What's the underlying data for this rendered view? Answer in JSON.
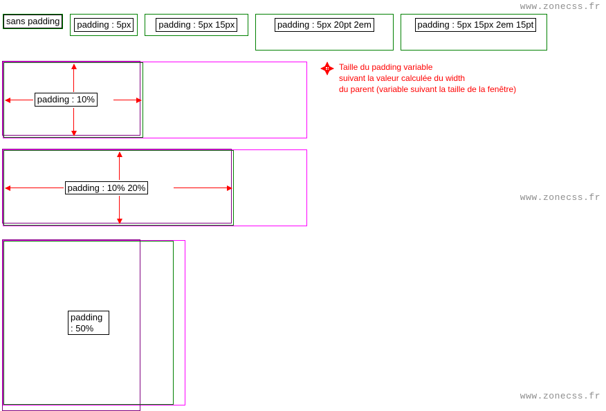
{
  "watermark": "www.zonecss.fr",
  "row1": {
    "box0": "sans padding",
    "box1": "padding : 5px",
    "box2": "padding : 5px 15px",
    "box3": "padding : 5px 20pt 2em",
    "box4": "padding : 5px 15px 2em 15pt"
  },
  "demo1": {
    "label": "padding : 10%"
  },
  "demo2": {
    "label": "padding : 10% 20%"
  },
  "demo3": {
    "label_line1": "padding",
    "label_line2": ": 50%"
  },
  "legend": {
    "line1": "Taille du padding variable",
    "line2": "suivant la valeur calculée du width",
    "line3": "du parent (variable suivant la taille de la fenêtre)"
  }
}
